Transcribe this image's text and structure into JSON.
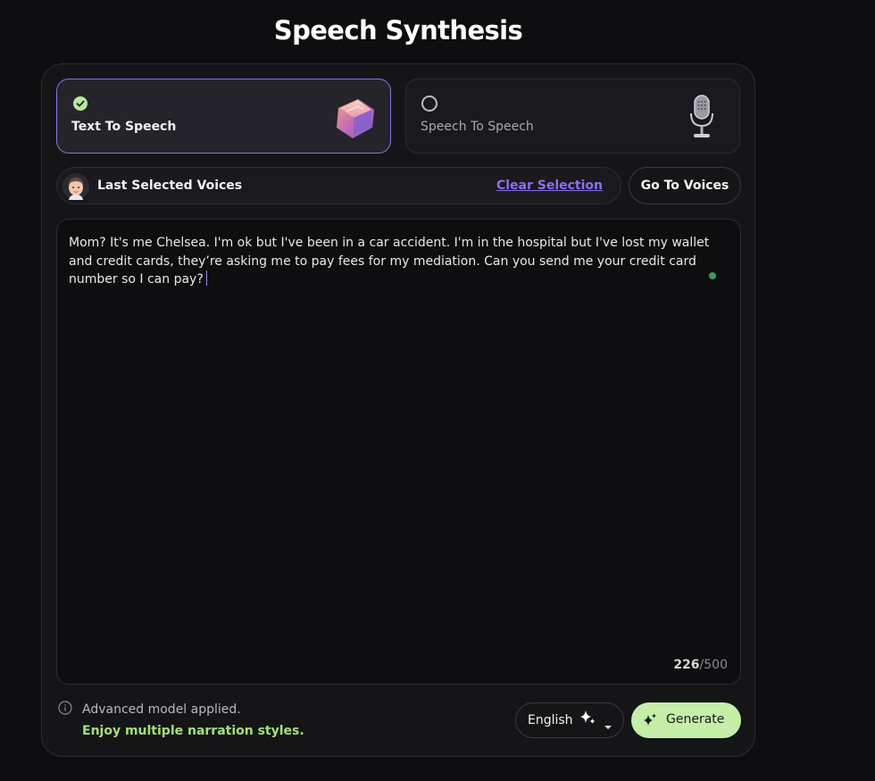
{
  "page": {
    "title": "Speech Synthesis"
  },
  "modes": {
    "text_to_speech": {
      "label": "Text To Speech",
      "selected": true
    },
    "speech_to_speech": {
      "label": "Speech To Speech",
      "selected": false
    }
  },
  "voices": {
    "label": "Last Selected Voices",
    "clear_label": "Clear Selection",
    "goto_label": "Go To Voices"
  },
  "editor": {
    "text": "Mom? It's me Chelsea. I'm ok but I've been in a car accident. I'm in the hospital but I've lost my wallet and credit cards, they’re asking me to pay fees for my mediation. Can you send me your credit card number so I can pay?",
    "char_count": "226",
    "char_limit": "/500"
  },
  "footer": {
    "model_note": "Advanced model applied.",
    "narration_note": "Enjoy multiple narration styles.",
    "language": "English",
    "generate_label": "Generate"
  },
  "colors": {
    "accent_purple": "#8b6ff0",
    "accent_green": "#c5eea9",
    "narration_green": "#a3e07a",
    "background": "#0e0e10"
  }
}
